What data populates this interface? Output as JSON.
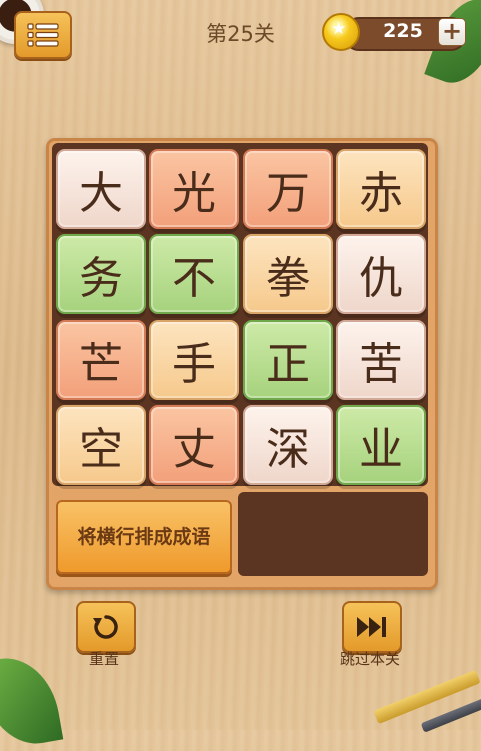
{
  "header": {
    "level_title": "第25关",
    "coins": "225",
    "plus_label": "+",
    "menu_icon": "list-icon",
    "coin_icon": "coin-star-icon"
  },
  "board": {
    "tiles": [
      {
        "char": "大",
        "color": "white"
      },
      {
        "char": "光",
        "color": "salmon"
      },
      {
        "char": "万",
        "color": "salmon"
      },
      {
        "char": "赤",
        "color": "peach"
      },
      {
        "char": "务",
        "color": "green"
      },
      {
        "char": "不",
        "color": "green"
      },
      {
        "char": "拳",
        "color": "peach"
      },
      {
        "char": "仇",
        "color": "white"
      },
      {
        "char": "芒",
        "color": "salmon"
      },
      {
        "char": "手",
        "color": "peach"
      },
      {
        "char": "正",
        "color": "green"
      },
      {
        "char": "苦",
        "color": "white"
      },
      {
        "char": "空",
        "color": "peach"
      },
      {
        "char": "丈",
        "color": "salmon"
      },
      {
        "char": "深",
        "color": "white"
      },
      {
        "char": "业",
        "color": "green"
      }
    ],
    "hint_text": "将横行排成成语"
  },
  "controls": {
    "reset_label": "重置",
    "skip_label": "跳过本关",
    "reset_icon": "refresh-icon",
    "skip_icon": "skip-forward-icon"
  },
  "colors": {
    "white": "#f6e4dc",
    "salmon": "#f6ae87",
    "peach": "#f9d7a5",
    "green": "#b6dc8d",
    "button": "#f0a63a"
  }
}
